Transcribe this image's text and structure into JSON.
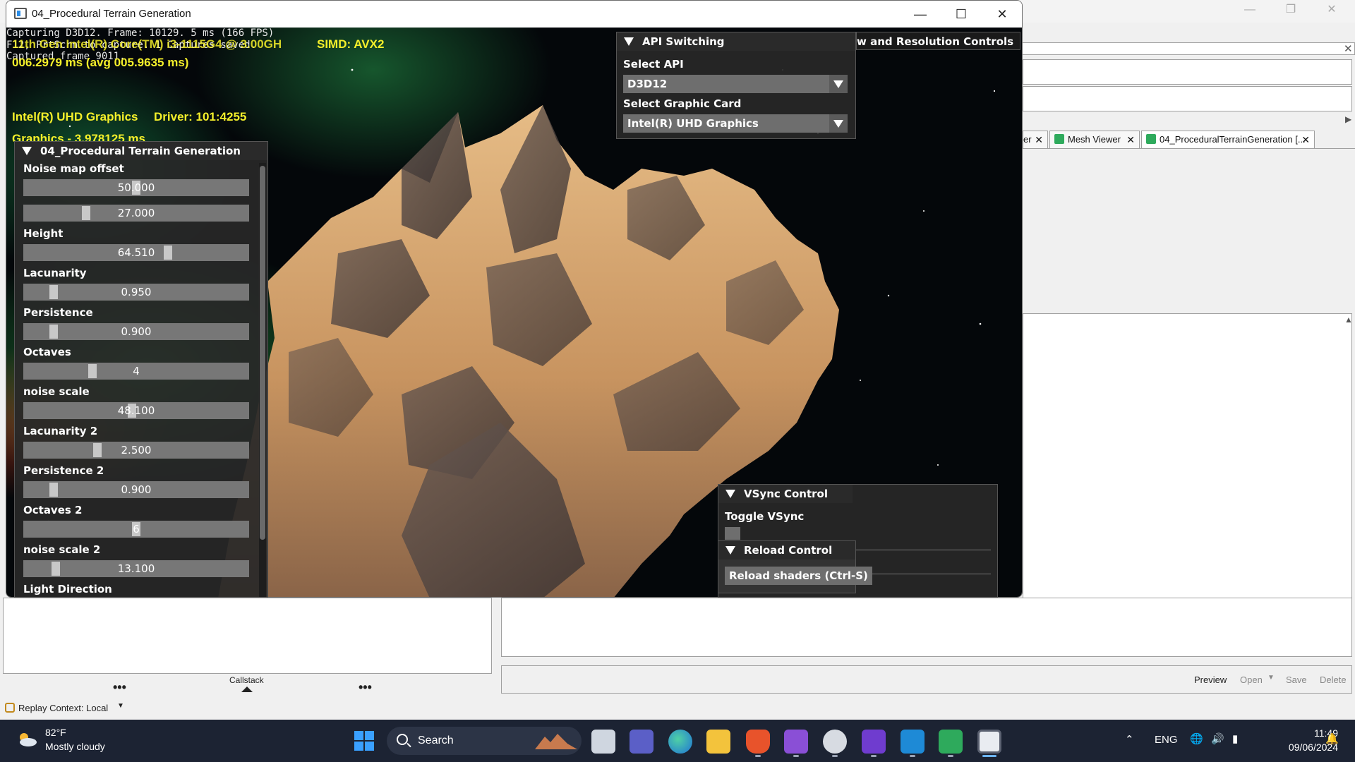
{
  "host": {
    "tabs": [
      {
        "label": "er"
      },
      {
        "label": "Mesh Viewer"
      },
      {
        "label": "04_ProceduralTerrainGeneration [..."
      }
    ],
    "bottom_left_label": "Callstack",
    "footer_buttons": {
      "preview": "Preview",
      "open": "Open",
      "save": "Save",
      "delete": "Delete"
    },
    "replay_context": "Replay Context: Local"
  },
  "demo_window": {
    "title": "04_Procedural Terrain Generation",
    "stats": {
      "capture_line": "Capturing D3D12.   Frame: 10129. 5 ms (166 FPS)",
      "capture_hint": "F12, PrtScrn to capture. 1 Captures saved.",
      "captured_frame": "Captured frame 9011.",
      "cpu_line": "11th Gen Intel(R) Core(TM) i3-1115G4 @ 3.00GH",
      "simd": "SIMD: AVX2",
      "frame_time": "006.2979 ms (avg 005.9635 ms)",
      "gpu_name": "Intel(R) UHD Graphics",
      "driver": "Driver: 101:4255",
      "graphics_time": "Graphics - 3.978125 ms"
    },
    "terrain_panel": {
      "title": "04_Procedural Terrain Generation",
      "controls": [
        {
          "label": "Noise map offset",
          "value": "50.000",
          "grab_pct": 0.5
        },
        {
          "label": "",
          "value": "27.000",
          "grab_pct": 0.27
        },
        {
          "label": "Height",
          "value": "64.510",
          "grab_pct": 0.645
        },
        {
          "label": "Lacunarity",
          "value": "0.950",
          "grab_pct": 0.12
        },
        {
          "label": "Persistence",
          "value": "0.900",
          "grab_pct": 0.12
        },
        {
          "label": "Octaves",
          "value": "4",
          "grab_pct": 0.3
        },
        {
          "label": "noise scale",
          "value": "48.100",
          "grab_pct": 0.48
        },
        {
          "label": "Lacunarity 2",
          "value": "2.500",
          "grab_pct": 0.32
        },
        {
          "label": "Persistence 2",
          "value": "0.900",
          "grab_pct": 0.12
        },
        {
          "label": "Octaves 2",
          "value": "6",
          "grab_pct": 0.5
        },
        {
          "label": "noise scale 2",
          "value": "13.100",
          "grab_pct": 0.13
        },
        {
          "label": "Light Direction",
          "value": "",
          "grab_pct": 0.5
        }
      ]
    },
    "api_panel": {
      "title": "API Switching",
      "select_api_label": "Select API",
      "select_api_value": "D3D12",
      "select_card_label": "Select Graphic Card",
      "select_card_value": "Intel(R) UHD Graphics"
    },
    "resolution_panel_title": "w and Resolution Controls",
    "vsync_panel": {
      "title": "VSync Control",
      "toggle_label": "Toggle VSync"
    },
    "reload_panel": {
      "title": "Reload Control",
      "button": "Reload shaders (Ctrl-S)"
    }
  },
  "taskbar": {
    "weather_temp": "82°F",
    "weather_desc": "Mostly cloudy",
    "search_label": "Search",
    "language": "ENG",
    "time": "11:49",
    "date": "09/06/2024"
  }
}
